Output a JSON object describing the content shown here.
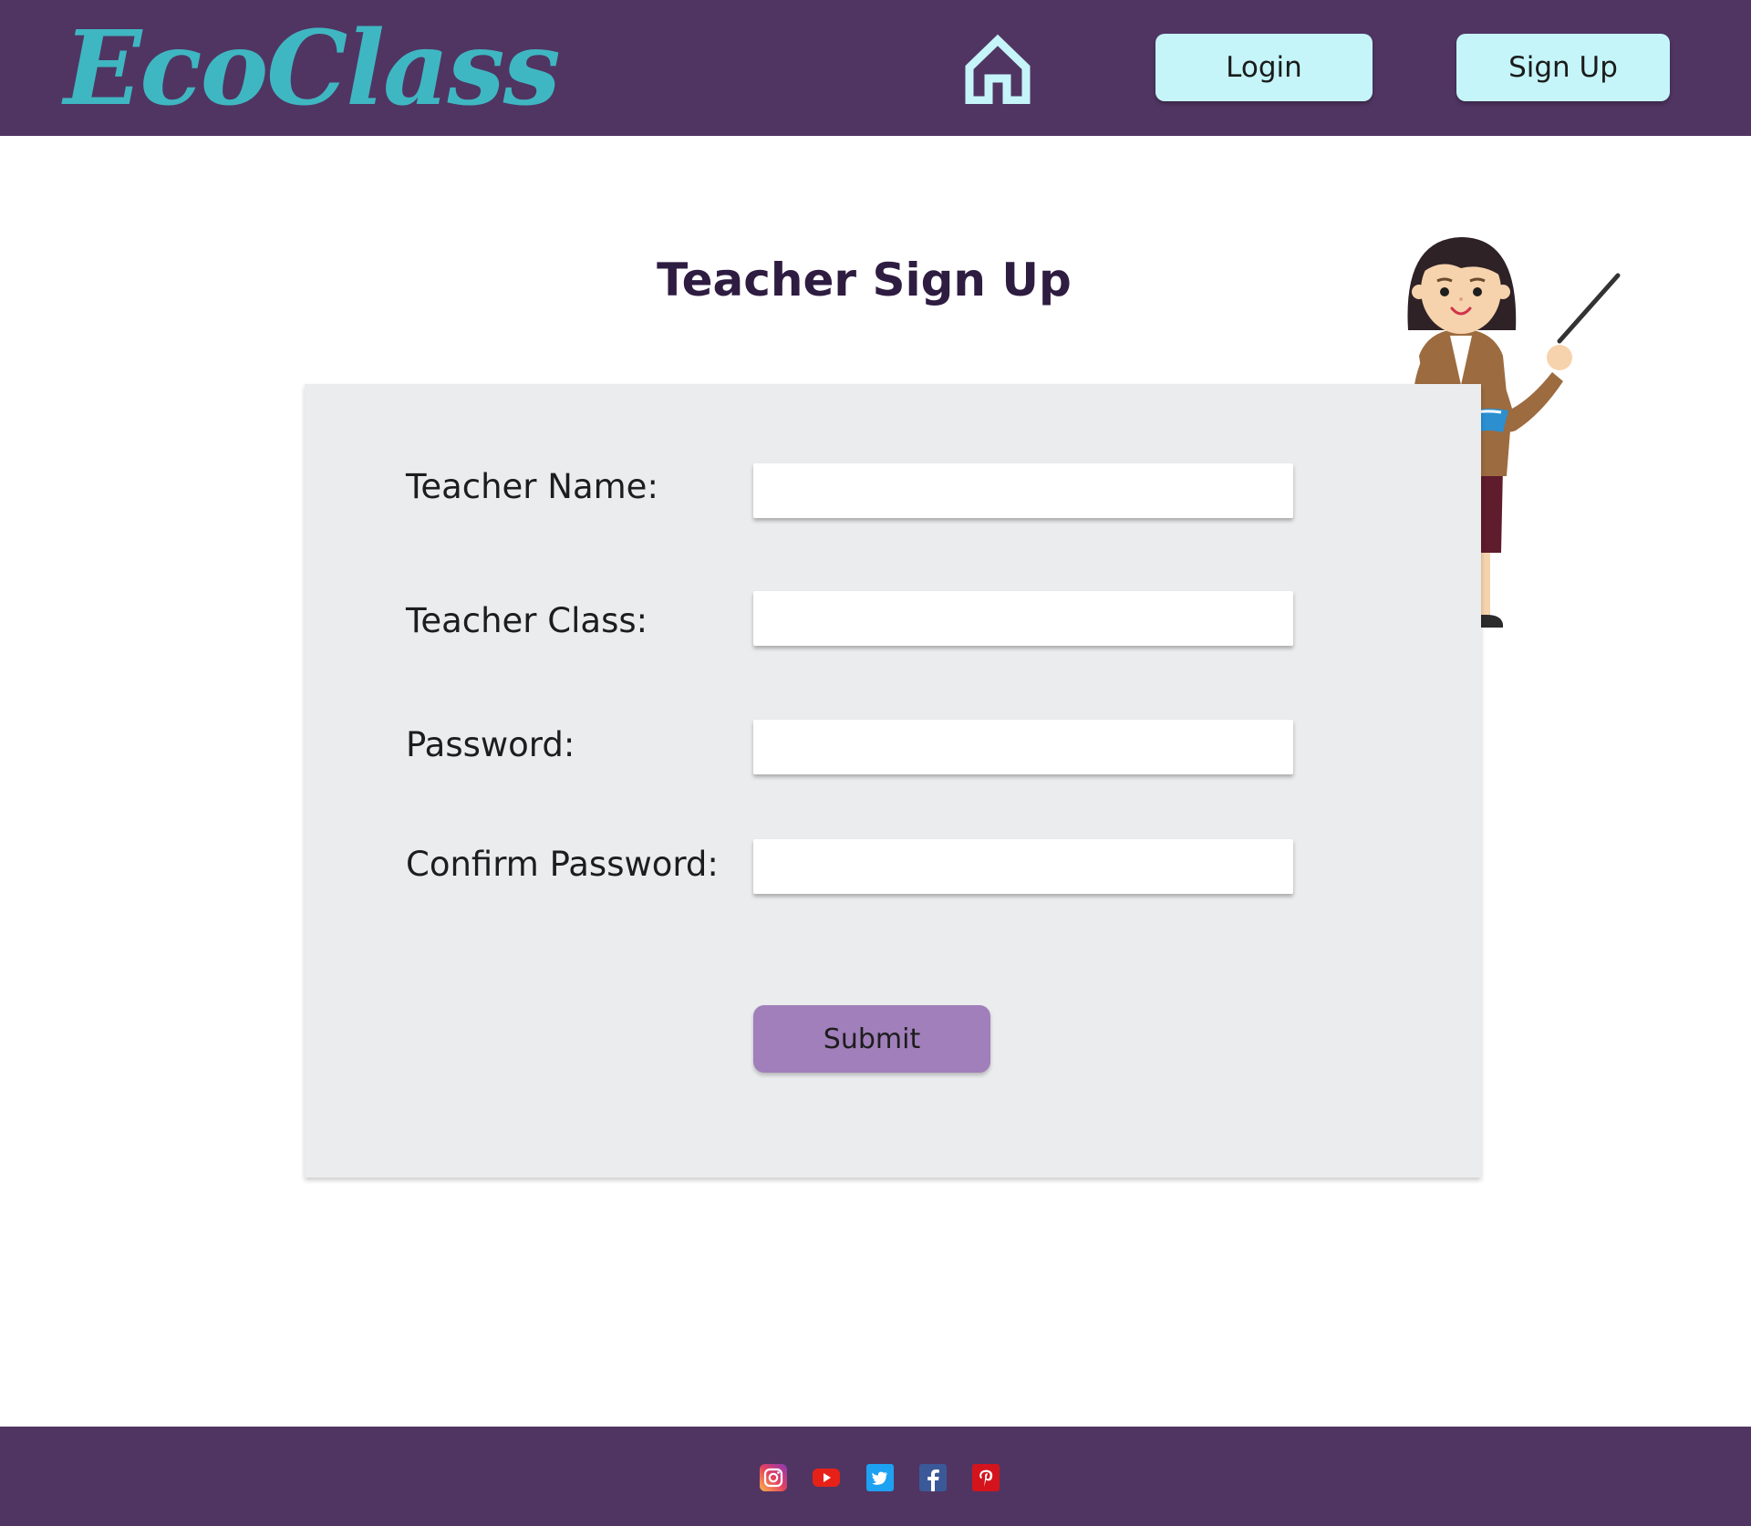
{
  "header": {
    "logo_text": "EcoClass",
    "home_icon": "home-icon",
    "login_label": "Login",
    "signup_label": "Sign Up"
  },
  "page": {
    "title": "Teacher Sign Up"
  },
  "form": {
    "fields": [
      {
        "label": "Teacher Name:",
        "value": ""
      },
      {
        "label": "Teacher Class:",
        "value": ""
      },
      {
        "label": "Password:",
        "value": ""
      },
      {
        "label": "Confirm Password:",
        "value": ""
      }
    ],
    "submit_label": "Submit"
  },
  "illustration": {
    "icon": "teacher-illustration"
  },
  "footer": {
    "social_icons": [
      "instagram-icon",
      "youtube-icon",
      "twitter-icon",
      "facebook-icon",
      "pinterest-icon"
    ]
  },
  "colors": {
    "header_bg": "#503562",
    "logo": "#3fb7c2",
    "nav_button": "#c5f5f9",
    "title": "#2e1c41",
    "form_bg": "#ebecee",
    "submit_button": "#a07fba"
  }
}
